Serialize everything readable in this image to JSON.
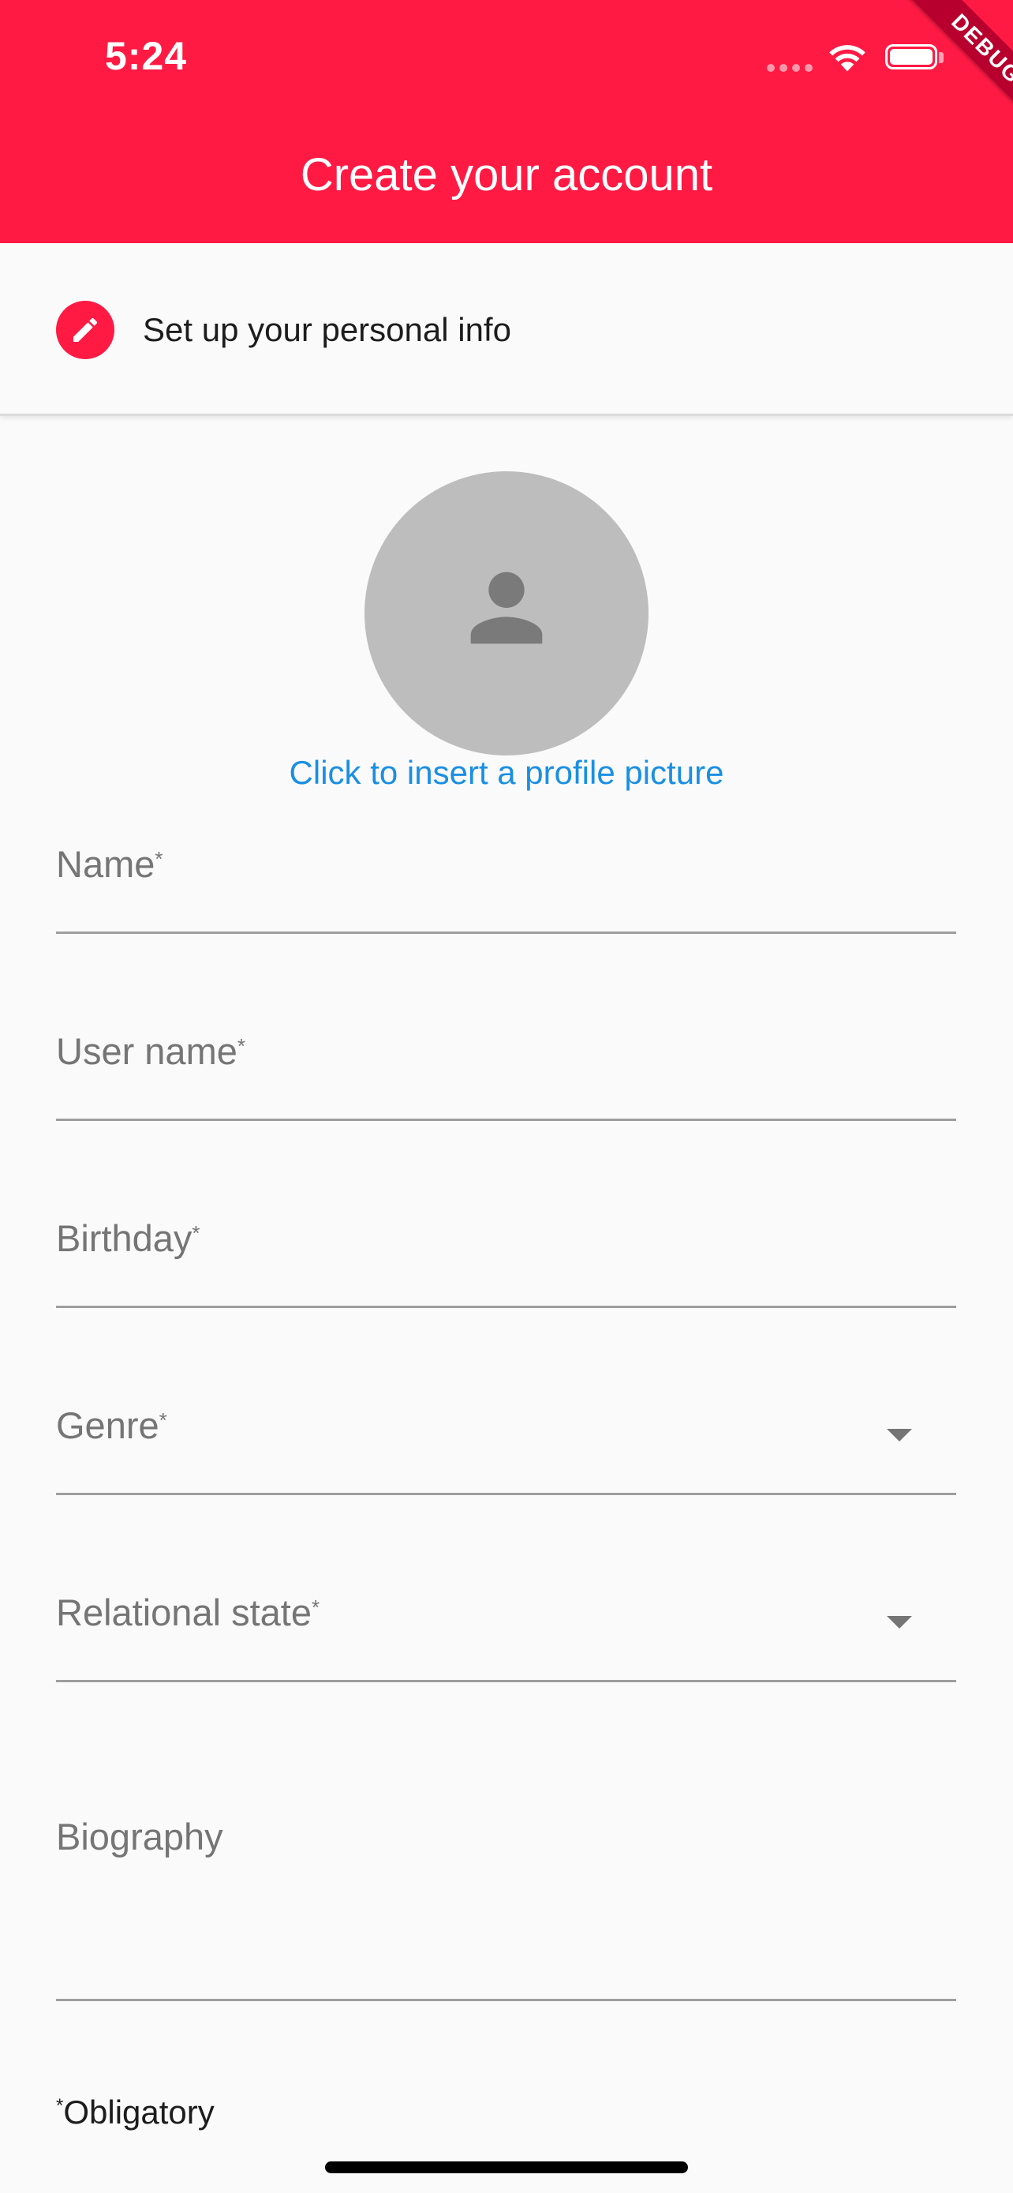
{
  "status_bar": {
    "time": "5:24",
    "icons": [
      "signal-icon",
      "wifi-icon",
      "battery-icon"
    ]
  },
  "debug_banner": "DEBUG",
  "app_bar": {
    "title": "Create your account"
  },
  "step": {
    "icon": "pencil-icon",
    "label": "Set up your personal info"
  },
  "profile": {
    "avatar_icon": "person-icon",
    "link_text": "Click to insert a profile picture"
  },
  "form": {
    "fields": [
      {
        "label": "Name",
        "required_mark": "*",
        "type": "text"
      },
      {
        "label": "User name",
        "required_mark": "*",
        "type": "text"
      },
      {
        "label": "Birthday",
        "required_mark": "*",
        "type": "text"
      },
      {
        "label": "Genre",
        "required_mark": "*",
        "type": "dropdown"
      },
      {
        "label": "Relational state",
        "required_mark": "*",
        "type": "dropdown"
      },
      {
        "label": "Biography",
        "required_mark": "",
        "type": "multiline"
      }
    ],
    "note_mark": "*",
    "note_text": "Obligatory"
  },
  "colors": {
    "primary": "#ff1a44",
    "link": "#1a8fe3",
    "avatar_bg": "#bdbdbd",
    "hint_text": "#757575"
  }
}
